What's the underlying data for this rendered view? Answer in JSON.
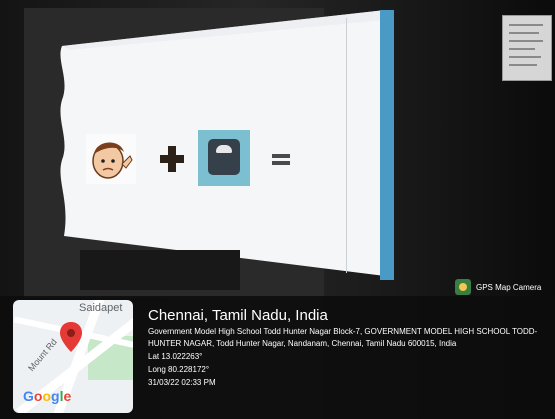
{
  "overlay": {
    "app_name": "GPS Map Camera",
    "location_title": "Chennai, Tamil Nadu, India",
    "address": "Government Model High School Todd Hunter Nagar Block-7, GOVERNMENT MODEL HIGH SCHOOL TODD-HUNTER NAGAR, Todd Hunter Nagar, Nandanam, Chennai, Tamil Nadu 600015, India",
    "latitude": "Lat 13.022263°",
    "longitude": "Long 80.228172°",
    "datetime": "31/03/22 02:33 PM"
  },
  "map": {
    "area_label": "Saidapet",
    "road_label": "Mount Rd",
    "brand": "Google"
  },
  "colors": {
    "screen_blue": "#4a9ac6",
    "scale_tile": "#7bbfd0",
    "pin_red": "#e53935"
  }
}
